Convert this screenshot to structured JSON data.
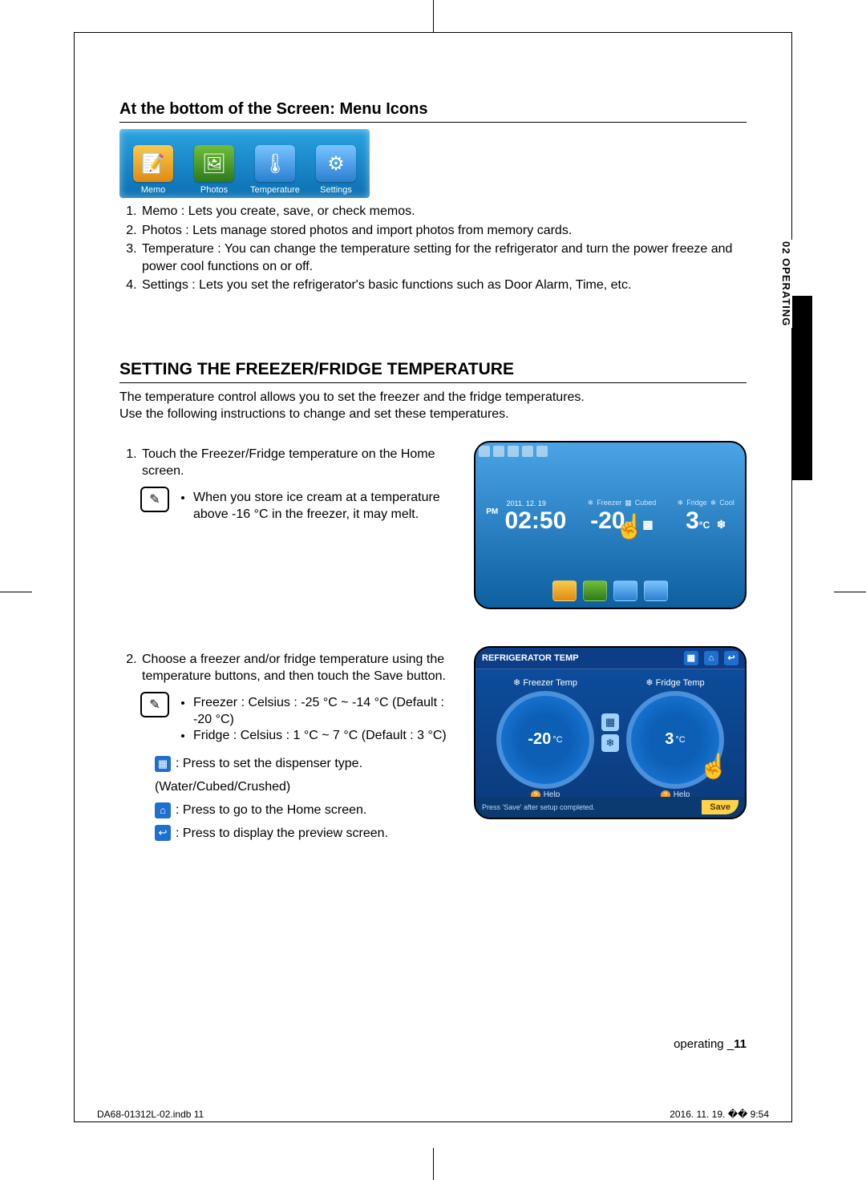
{
  "section1": {
    "heading": "At the bottom of the Screen: Menu Icons",
    "menu": {
      "memo": "Memo",
      "photos": "Photos",
      "temperature": "Temperature",
      "settings": "Settings"
    },
    "items": {
      "i1": "Memo : Lets you create, save, or check memos.",
      "i2": "Photos : Lets manage stored photos and import photos from memory cards.",
      "i3": "Temperature : You can change the temperature setting for the refrigerator and turn the power freeze and power cool functions on or off.",
      "i4": "Settings : Lets you set the refrigerator's basic functions such as Door Alarm, Time, etc."
    }
  },
  "section2": {
    "heading": "SETTING THE FREEZER/FRIDGE TEMPERATURE",
    "intro1": "The temperature control allows you to set the freezer and the fridge temperatures.",
    "intro2": "Use the following instructions to change and set these temperatures.",
    "step1": "Touch the Freezer/Fridge temperature on the Home screen.",
    "note1": "When you store ice cream at a temperature above -16 °C in the freezer, it may melt.",
    "step2": "Choose a freezer and/or fridge temperature using the temperature buttons, and then touch the Save button.",
    "note2a": "Freezer : Celsius : -25 °C ~ -14 °C (Default : -20 °C)",
    "note2b": "Fridge : Celsius : 1 °C ~ 7 °C (Default : 3 °C)",
    "iconHelp": {
      "disp": ": Press to set the dispenser type. (Water/Cubed/Crushed)",
      "home": ": Press to go to the Home screen.",
      "back": ": Press to display the preview screen."
    }
  },
  "fig1": {
    "date": "2011. 12. 19",
    "pm": "PM",
    "time": "02:50",
    "freezerLbl": "Freezer",
    "cubedLbl": "Cubed",
    "fridgeLbl": "Fridge",
    "coolLbl": "Cool",
    "freezerTemp": "-20",
    "fridgeTemp": "3",
    "unit": "°C"
  },
  "fig2": {
    "title": "REFRIGERATOR TEMP",
    "freezerLbl": "Freezer Temp",
    "fridgeLbl": "Fridge Temp",
    "freezerTemp": "-20",
    "fridgeTemp": "3",
    "unit": "°C",
    "help": "Help",
    "footnote": "Press 'Save' after setup completed.",
    "save": "Save"
  },
  "sideTab": "02  OPERATING",
  "footer": {
    "section": "operating _",
    "page": "11"
  },
  "printFoot": {
    "left": "DA68-01312L-02.indb   11",
    "right": "2016. 11. 19.   �� 9:54"
  }
}
